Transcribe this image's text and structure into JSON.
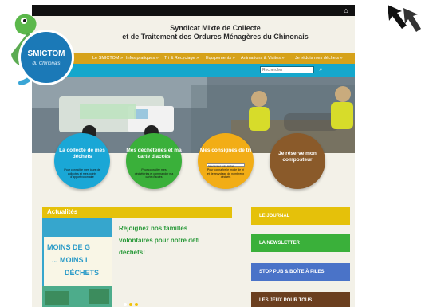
{
  "site": {
    "header": {
      "title_line1": "Syndicat Mixte de Collecte",
      "title_line2": "et de Traitement des Ordures Ménagères du Chinonais"
    },
    "logo": {
      "text": "SMICTOM",
      "subtext": "du Chinonais"
    },
    "nav": {
      "items": [
        {
          "label": "Le SMICTOM »"
        },
        {
          "label": "Infos pratiques »"
        },
        {
          "label": "Tri & Recyclage »"
        },
        {
          "label": "Equipements »"
        },
        {
          "label": "Animations & Visites »"
        },
        {
          "label": "Je réduis mes déchets »"
        }
      ]
    },
    "search": {
      "placeholder": "Rechercher"
    },
    "circles": [
      {
        "label": "La collecte de mes déchets",
        "desc": "Pour connaître mes jours de collectes et mes points d'apport volontaire",
        "color": "#1aa7d6"
      },
      {
        "label": "Mes déchèteries et ma carte d'accès",
        "desc": "Pour connaître mes déchèteries et commander ma carte d'accès",
        "color": "#3ab03a"
      },
      {
        "label": "Mes consignes de tri",
        "sub": "Sélectionnez votre déchet",
        "desc": "Pour connaître le mode de tri et de recyclage de nombreux déchets",
        "color": "#f2ad16"
      },
      {
        "label": "Je réserve mon composteur",
        "desc": "",
        "color": "#8a5a2a"
      }
    ],
    "news": {
      "section_title": "Actualités",
      "image_text": {
        "l1": "MOINS DE G",
        "l2": "... MOINS I",
        "l3": "DÉCHETS"
      },
      "headline": {
        "l1": "Rejoignez nos familles",
        "l2": "volontaires pour notre défi",
        "l3": "déchets!"
      }
    },
    "side_buttons": [
      {
        "label": "LE JOURNAL",
        "color": "#e5c10a"
      },
      {
        "label": "LA NEWSLETTER",
        "color": "#3ab03a"
      },
      {
        "label": "STOP PUB & BOÎTE À PILES",
        "color": "#4a73c8"
      },
      {
        "label": "LES JEUX POUR TOUS",
        "color": "#6b3f1f"
      }
    ]
  }
}
